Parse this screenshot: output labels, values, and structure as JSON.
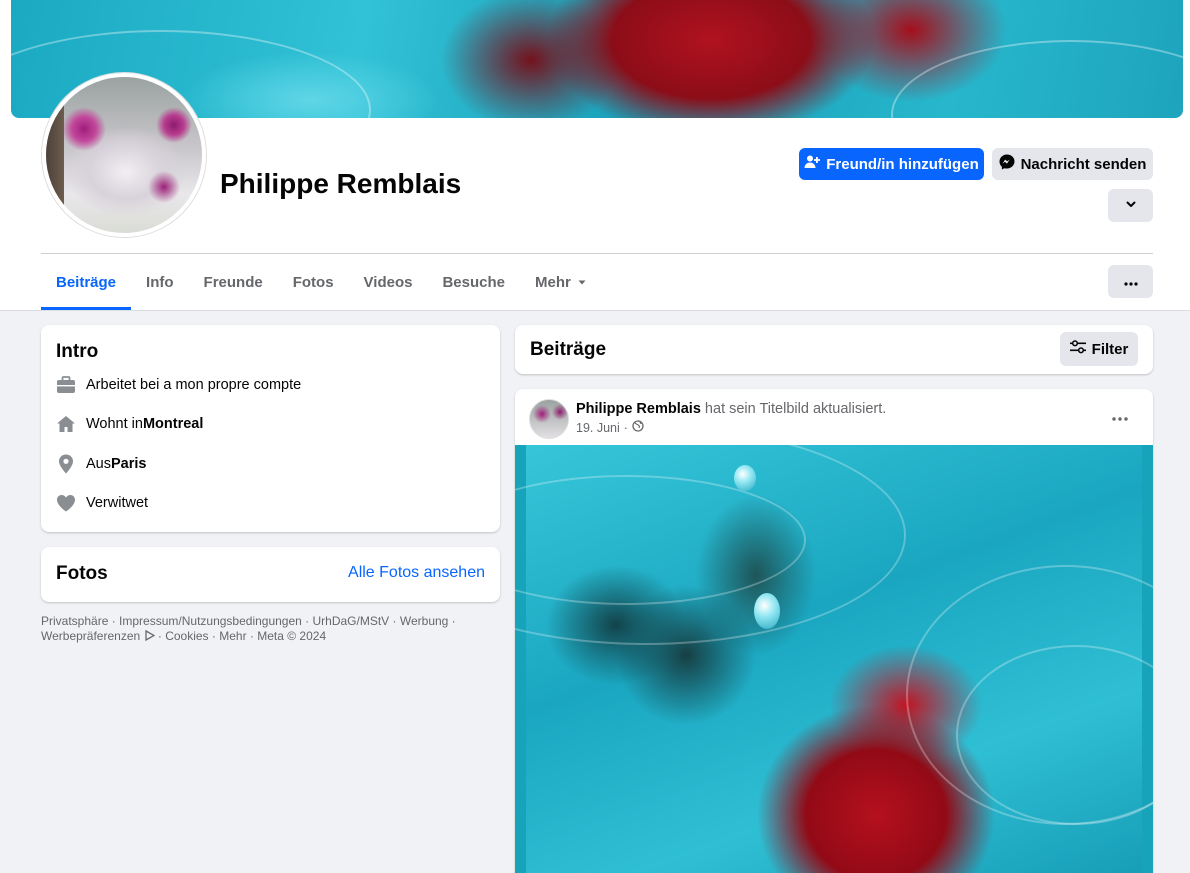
{
  "profile": {
    "name": "Philippe Remblais",
    "add_friend_label": "Freund/in hinzufügen",
    "message_label": "Nachricht senden"
  },
  "tabs": [
    {
      "label": "Beiträge",
      "active": true
    },
    {
      "label": "Info"
    },
    {
      "label": "Freunde"
    },
    {
      "label": "Fotos"
    },
    {
      "label": "Videos"
    },
    {
      "label": "Besuche"
    },
    {
      "label": "Mehr"
    }
  ],
  "intro": {
    "title": "Intro",
    "work": {
      "prefix": "Arbeitet bei a mon propre compte"
    },
    "lives": {
      "prefix": "Wohnt in ",
      "value": "Montreal"
    },
    "from": {
      "prefix": "Aus ",
      "value": "Paris"
    },
    "relationship": {
      "prefix": "Verwitwet"
    }
  },
  "photos": {
    "title": "Fotos",
    "link": "Alle Fotos ansehen"
  },
  "footer": {
    "links": [
      "Privatsphäre",
      "Impressum/Nutzungsbedingungen",
      "UrhDaG/MStV",
      "Werbung",
      "Werbepräferenzen",
      "Cookies",
      "Mehr"
    ],
    "copyright": "Meta © 2024",
    "sep": " · "
  },
  "posts": {
    "title": "Beiträge",
    "filter_label": "Filter",
    "post": {
      "author": "Philippe Remblais",
      "action": " hat sein Titelbild aktualisiert.",
      "date": "19. Juni",
      "dot": " · "
    }
  },
  "colors": {
    "accent": "#0866ff",
    "background": "#f0f2f5",
    "button_gray": "#e4e6eb",
    "secondary_text": "#65676b"
  },
  "icons": [
    "add-friend-icon",
    "messenger-icon",
    "chevron-down-icon",
    "more-icon",
    "briefcase-icon",
    "home-icon",
    "location-pin-icon",
    "heart-icon",
    "filter-icon",
    "globe-icon",
    "ad-choices-icon"
  ]
}
